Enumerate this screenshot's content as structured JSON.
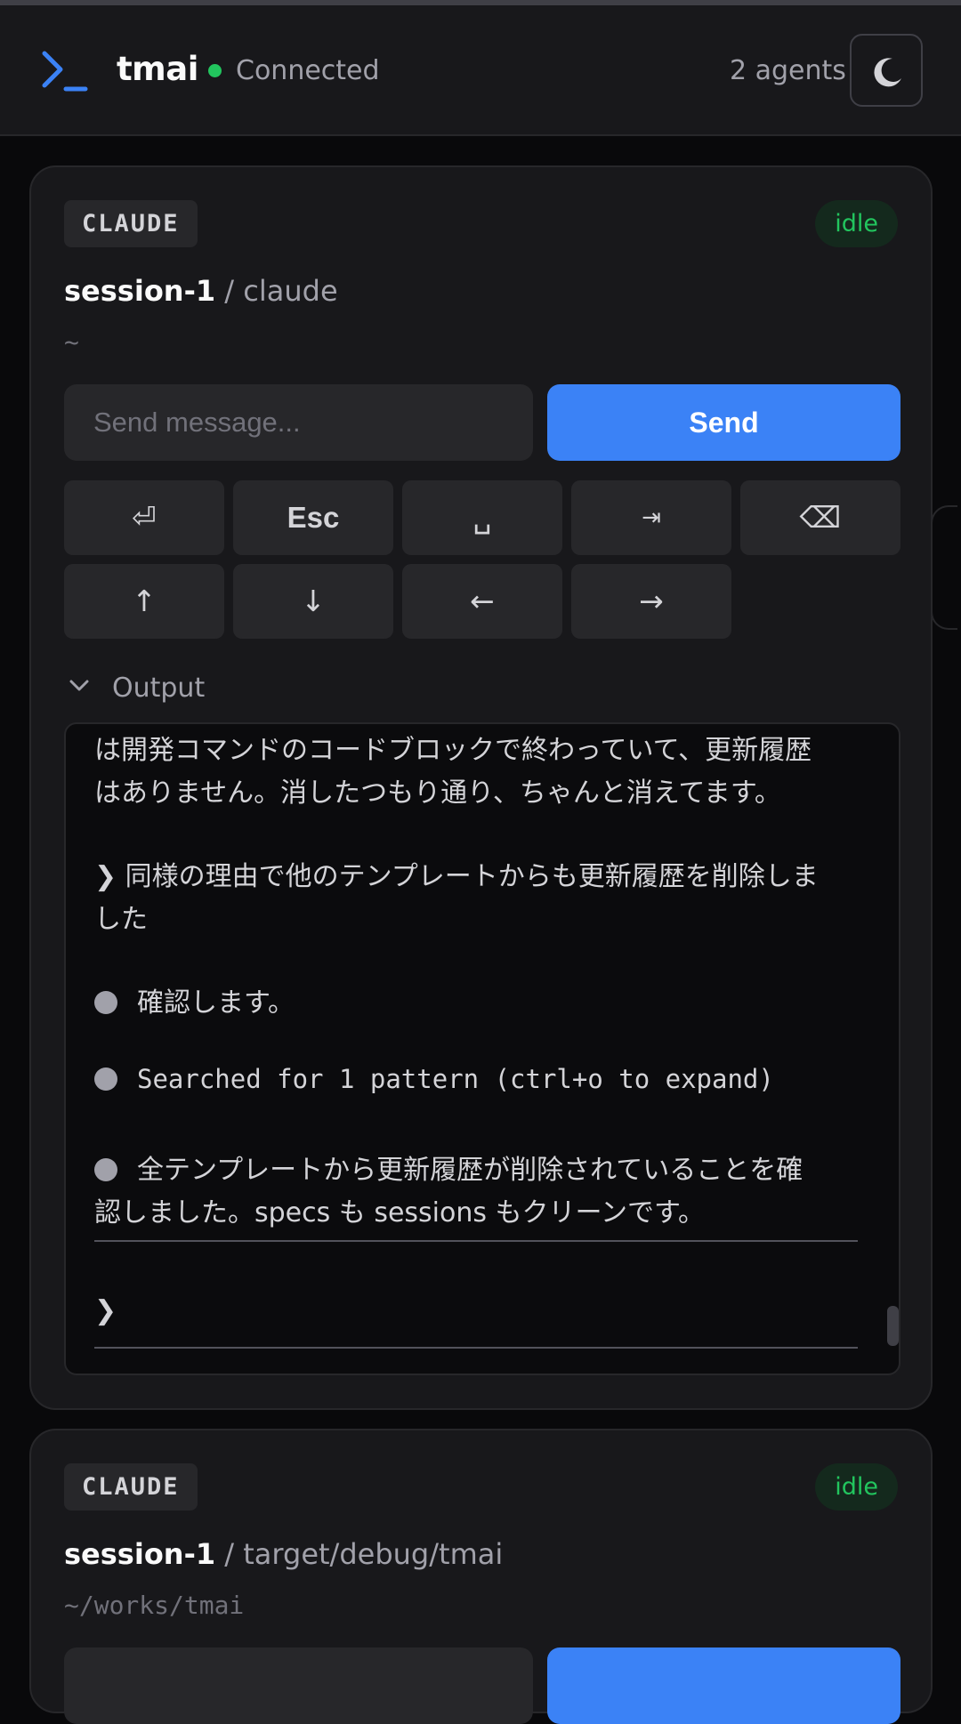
{
  "header": {
    "app_name": "tmai",
    "connection_status": "Connected",
    "connection_color": "#22c55e",
    "agents_count": "2 agents",
    "logo_icon": "terminal-prompt-icon",
    "theme_icon": "moon-icon"
  },
  "colors": {
    "accent": "#3b82f6",
    "idle": "#22c55e",
    "background": "#09090b",
    "card": "#18181b"
  },
  "agents": [
    {
      "type": "CLAUDE",
      "status": "idle",
      "session": "session-1",
      "command": " / claude",
      "cwd": "~",
      "input_placeholder": "Send message...",
      "send_label": "Send",
      "keys_row1": [
        "⏎",
        "Esc",
        "␣",
        "⇥",
        "⌫"
      ],
      "keys_row2": [
        "↑",
        "↓",
        "←",
        "→"
      ],
      "output_label": "Output",
      "output_lines": [
        "は開発コマンドのコードブロックで終わっていて、更新履歴",
        "はありません。消したつもり通り、ちゃんと消えてます。",
        "❯ 同様の理由で他のテンプレートからも更新履歴を削除しま",
        "した",
        "確認します。",
        "Searched for 1 pattern (ctrl+o to expand)",
        "全テンプレートから更新履歴が削除されていることを確",
        "認しました。spec​s も sessions もクリーンです。",
        "❯"
      ]
    },
    {
      "type": "CLAUDE",
      "status": "idle",
      "session": "session-1",
      "command": " / target/debug/tmai",
      "cwd": "~/works/tmai"
    }
  ]
}
